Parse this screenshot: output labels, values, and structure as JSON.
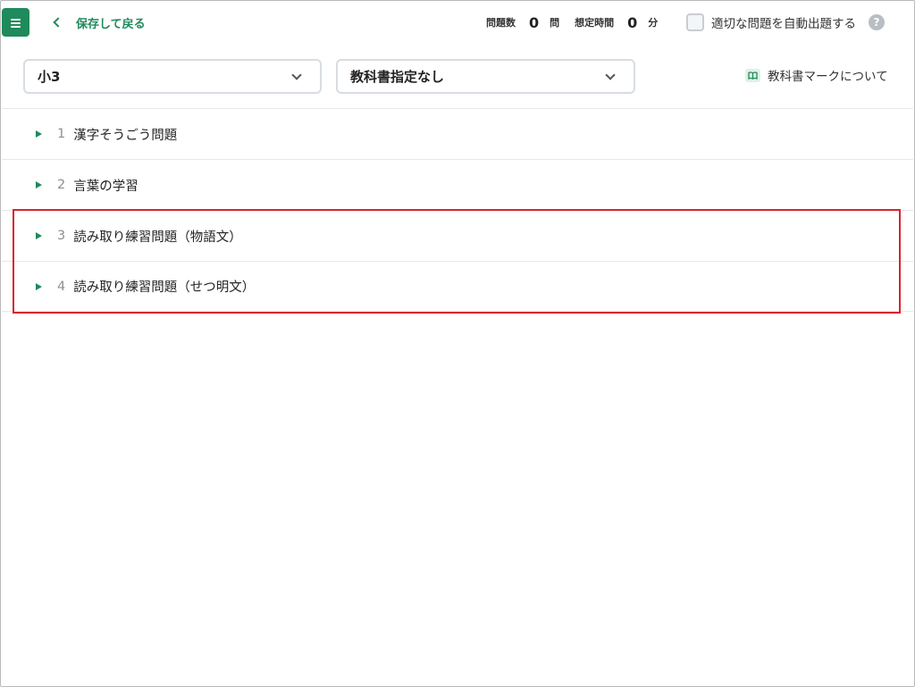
{
  "header": {
    "back_label": "保存して戻る",
    "question_count_label": "問題数",
    "question_count": "0",
    "question_unit": "問",
    "time_label": "想定時間",
    "time_value": "0",
    "time_unit": "分",
    "auto_label": "適切な問題を自動出題する",
    "help_glyph": "?"
  },
  "filters": {
    "grade": "小3",
    "textbook": "教科書指定なし",
    "textbook_mark_link": "教科書マークについて"
  },
  "sections": [
    {
      "index": "1",
      "title": "漢字そうごう問題"
    },
    {
      "index": "2",
      "title": "言葉の学習"
    },
    {
      "index": "3",
      "title": "読み取り練習問題（物語文）"
    },
    {
      "index": "4",
      "title": "読み取り練習問題（せつ明文）"
    }
  ],
  "colors": {
    "accent": "#1f8a5b",
    "highlight": "#d9232e"
  }
}
